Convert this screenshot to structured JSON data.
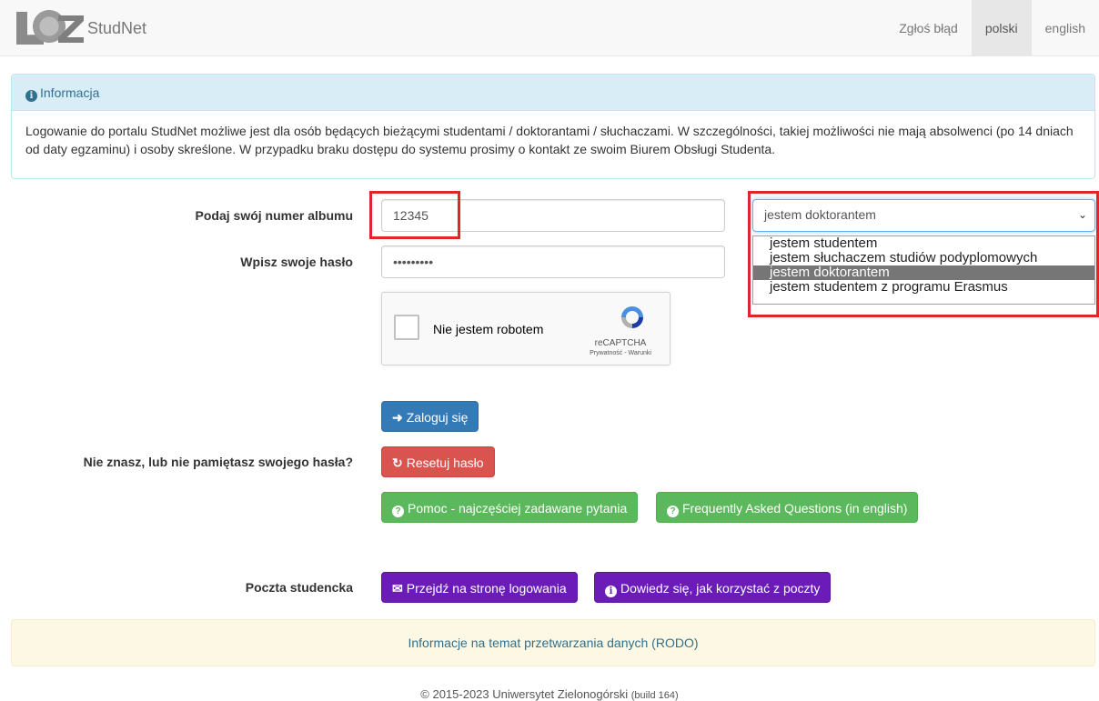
{
  "navbar": {
    "brand": "StudNet",
    "links": [
      {
        "label": "Zgłoś błąd",
        "active": false
      },
      {
        "label": "polski",
        "active": true
      },
      {
        "label": "english",
        "active": false
      }
    ]
  },
  "info": {
    "title": "Informacja",
    "body": "Logowanie do portalu StudNet możliwe jest dla osób będących bieżącymi studentami / doktorantami / słuchaczami. W szczególności, takiej możliwości nie mają absolwenci (po 14 dniach od daty egzaminu) i osoby skreślone. W przypadku braku dostępu do systemu prosimy o kontakt ze swoim Biurem Obsługi Studenta."
  },
  "form": {
    "album_label": "Podaj swój numer albumu",
    "album_value": "12345",
    "password_label": "Wpisz swoje hasło",
    "password_value": "•••••••••",
    "role_selected": "jestem doktorantem",
    "role_options": [
      "jestem studentem",
      "jestem słuchaczem studiów podyplomowych",
      "jestem doktorantem",
      "jestem studentem z programu Erasmus"
    ],
    "selected_index": 2
  },
  "captcha": {
    "label": "Nie jestem robotem",
    "brand": "reCAPTCHA",
    "links": "Prywatność - Warunki"
  },
  "buttons": {
    "login": "Zaloguj się",
    "reset_label": "Nie znasz, lub nie pamiętasz swojego hasła?",
    "reset": "Resetuj hasło",
    "faq_pl": "Pomoc - najczęściej zadawane pytania",
    "faq_en": "Frequently Asked Questions (in english)",
    "mail_label": "Poczta studencka",
    "mail_login": "Przejdź na stronę logowania",
    "mail_help": "Dowiedz się, jak korzystać z poczty"
  },
  "rodo": "Informacje na temat przetwarzania danych (RODO)",
  "footer": {
    "copyright": "© 2015-2023 Uniwersytet Zielonogórski",
    "build": "(build 164)"
  },
  "colors": {
    "primary": "#337ab7",
    "danger": "#d9534f",
    "success": "#5cb85c",
    "purple": "#6a1bb8",
    "highlight": "#e0252e"
  }
}
